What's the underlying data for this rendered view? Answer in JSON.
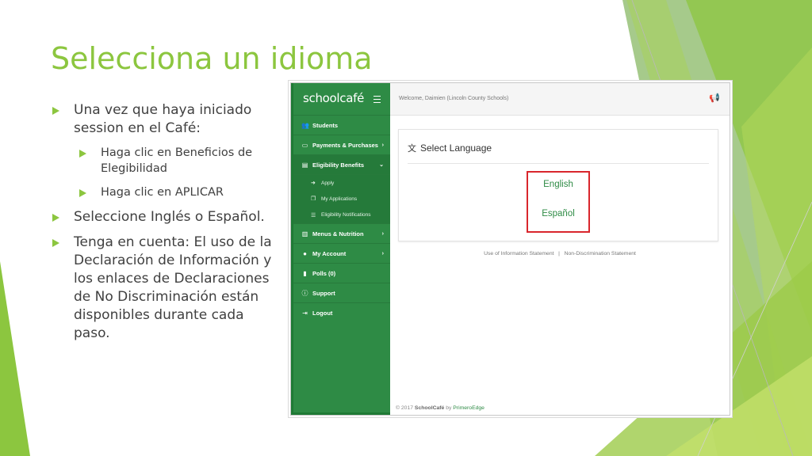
{
  "slide": {
    "title": "Selecciona un idioma",
    "bullets": [
      {
        "text": "Una vez que haya iniciado session en el Café:"
      },
      {
        "text": "Haga clic en Beneficios de Elegibilidad"
      },
      {
        "text": "Haga clic en APLICAR"
      },
      {
        "text": "Seleccione Inglés o Español."
      },
      {
        "text": "Tenga en cuenta:  El uso de la Declaración de Información y los enlaces de Declaraciones de No Discriminación están disponibles durante cada paso."
      }
    ]
  },
  "app": {
    "logo": "schoolcafé",
    "welcome": "Welcome, Daimien (Lincoln County Schools)",
    "nav": [
      {
        "label": "Students",
        "icon": "users-icon"
      },
      {
        "label": "Payments & Purchases",
        "icon": "money-icon"
      },
      {
        "label": "Eligibility Benefits",
        "icon": "document-icon"
      },
      {
        "label": "Menus & Nutrition",
        "icon": "book-icon"
      },
      {
        "label": "My Account",
        "icon": "user-icon"
      },
      {
        "label": "Polls (0)",
        "icon": "bar-chart-icon"
      },
      {
        "label": "Support",
        "icon": "info-icon"
      },
      {
        "label": "Logout",
        "icon": "logout-icon"
      }
    ],
    "subnav": [
      {
        "label": "Apply",
        "icon": "arrow-circle-icon"
      },
      {
        "label": "My Applications",
        "icon": "copy-icon"
      },
      {
        "label": "Eligibility Notifications",
        "icon": "list-icon"
      }
    ],
    "language_card": {
      "title": "Select Language",
      "options": [
        "English",
        "Español"
      ]
    },
    "footer": {
      "use_statement": "Use of Information Statement",
      "separator": "|",
      "non_discrimination": "Non-Discrimination Statement"
    },
    "copyright": {
      "prefix": "© 2017",
      "brand": "SchoolCafé",
      "by": "by",
      "company": "PrimeroEdge"
    }
  },
  "colors": {
    "accent_green": "#8cc63f",
    "sidebar_green": "#2e8b45",
    "highlight_red": "#d9262c"
  }
}
